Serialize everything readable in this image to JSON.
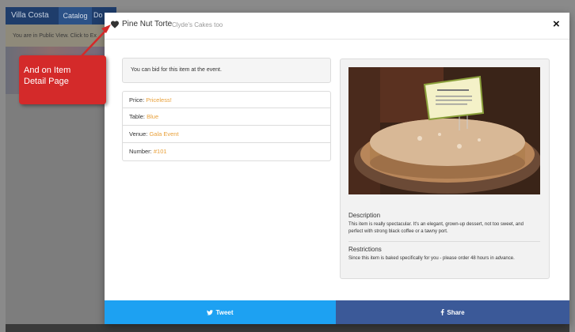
{
  "background_page": {
    "brand": "Villa Costa",
    "nav_catalog": "Catalog",
    "nav_partial": "Do",
    "banner_text": "You are in Public View. Click to Ex"
  },
  "callout": {
    "line1": "And on Item",
    "line2": "Detail Page"
  },
  "modal": {
    "title": "Pine Nut Torte",
    "subtitle": "Clyde's Cakes too",
    "bid_notice": "You can bid for this item at the event.",
    "details": [
      {
        "label": "Price:",
        "value": "Priceless!"
      },
      {
        "label": "Table:",
        "value": "Blue"
      },
      {
        "label": "Venue:",
        "value": "Gala Event"
      },
      {
        "label": "Number:",
        "value": "#101"
      }
    ],
    "description_label": "Description",
    "description_text": "This item is really spectacular.    It's an elegant, grown-up dessert, not too sweet, and perfect with strong black coffee or a tawny port.",
    "restrictions_label": "Restrictions",
    "restrictions_text": "Since this item is baked specifically for you - please order 48 hours in advance.",
    "tweet_label": "Tweet",
    "share_label": "Share"
  },
  "colors": {
    "accent_value": "#e8a03a",
    "tweet": "#1da1f2",
    "share": "#3b5998",
    "callout": "#d42a2a"
  },
  "icons": [
    "heart-icon",
    "close-icon",
    "twitter-icon",
    "facebook-icon"
  ]
}
